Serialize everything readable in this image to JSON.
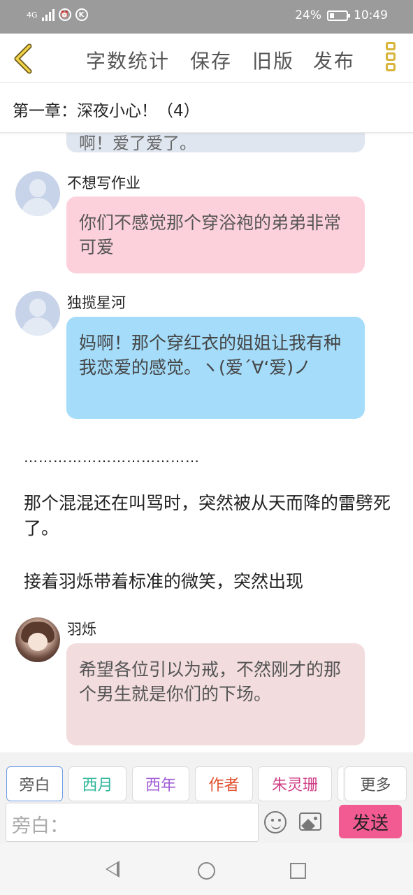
{
  "status": {
    "network": "4G",
    "battery": "24%",
    "time": "10:49",
    "icons": [
      "signal-icon",
      "alarm-icon",
      "k-app-icon",
      "battery-icon"
    ]
  },
  "toolbar": {
    "back_icon": "chevron-left-icon",
    "word_count": "字数统计",
    "save": "保存",
    "old_version": "旧版",
    "publish": "发布",
    "more_icon": "more-vertical-icon"
  },
  "chapter": {
    "title": "第一章：深夜小心！（4）"
  },
  "messages": {
    "partial": "啊！爱了爱了。",
    "m1": {
      "speaker": "不想写作业",
      "text": "你们不感觉那个穿浴袍的弟弟非常可爱"
    },
    "m2": {
      "speaker": "独揽星河",
      "text": "妈啊！那个穿红衣的姐姐让我有种我恋爱的感觉。ヽ(爱´∀‘爱)ノ"
    },
    "m3": {
      "speaker": "羽烁",
      "text": "希望各位引以为戒，不然刚才的那个男生就是你们的下场。"
    }
  },
  "narration": {
    "dots": "………………………………",
    "p1": "那个混混还在叫骂时，突然被从天而降的雷劈死了。",
    "p2": "接着羽烁带着标准的微笑，突然出现"
  },
  "chips": {
    "narrator": {
      "label": "旁白",
      "color": "#555555"
    },
    "xiyue": {
      "label": "西月",
      "color": "#2fb59b"
    },
    "xinian": {
      "label": "西年",
      "color": "#a05cd6"
    },
    "author": {
      "label": "作者",
      "color": "#e0502e"
    },
    "zhulingshan": {
      "label": "朱灵珊",
      "color": "#d03f86"
    },
    "more": {
      "label": "更多",
      "color": "#555555"
    }
  },
  "input": {
    "placeholder": "旁白：",
    "send": "发送"
  },
  "colors": {
    "accent_pink": "#f25b91",
    "bubble_pink": "#fdd1dc",
    "bubble_blue": "#a4dcfa",
    "bubble_rose": "#f2dcdd",
    "more_icon": "#d8b53a"
  }
}
